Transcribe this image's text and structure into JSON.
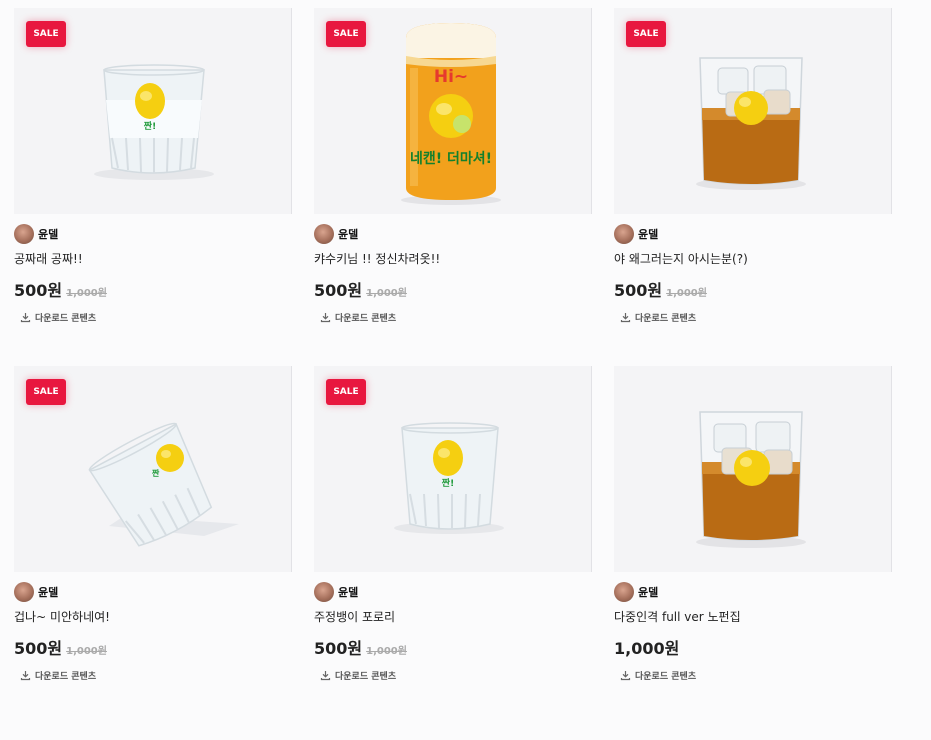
{
  "sale_badge": "SALE",
  "colors": {
    "sale": "#e8173f",
    "lemon": "#f5cf11",
    "whiskey": "#b96b14",
    "beer": "#f2a11c"
  },
  "products": [
    {
      "image": "soju-glass-lemon",
      "sale": true,
      "author": "윤델",
      "title": "공짜래 공짜!!",
      "price": "500원",
      "original_price": "1,000원",
      "download": "다운로드 콘텐츠"
    },
    {
      "image": "beer-can-glass-lemon",
      "sale": true,
      "author": "윤델",
      "title": "캬수키님 !! 정신차려옷!!",
      "price": "500원",
      "original_price": "1,000원",
      "download": "다운로드 콘텐츠",
      "glass_text_top": "Hi~",
      "glass_text_bottom": "네캔! 더마셔!"
    },
    {
      "image": "whiskey-glass-lemon",
      "sale": true,
      "author": "윤델",
      "title": "야 왜그러는지 아시는분(?)",
      "price": "500원",
      "original_price": "1,000원",
      "download": "다운로드 콘텐츠"
    },
    {
      "image": "tipped-soju-glass-lemon",
      "sale": true,
      "author": "윤델",
      "title": "겁나~ 미안하네여!",
      "price": "500원",
      "original_price": "1,000원",
      "download": "다운로드 콘텐츠"
    },
    {
      "image": "soju-glass-lemon",
      "sale": true,
      "author": "윤델",
      "title": "주정뱅이 포로리",
      "price": "500원",
      "original_price": "1,000원",
      "download": "다운로드 콘텐츠"
    },
    {
      "image": "whiskey-glass-lemon",
      "sale": false,
      "author": "윤델",
      "title": "다중인격 full ver 노펀집",
      "price": "1,000원",
      "original_price": "",
      "download": "다운로드 콘텐츠"
    }
  ],
  "glass_label": "짠!"
}
